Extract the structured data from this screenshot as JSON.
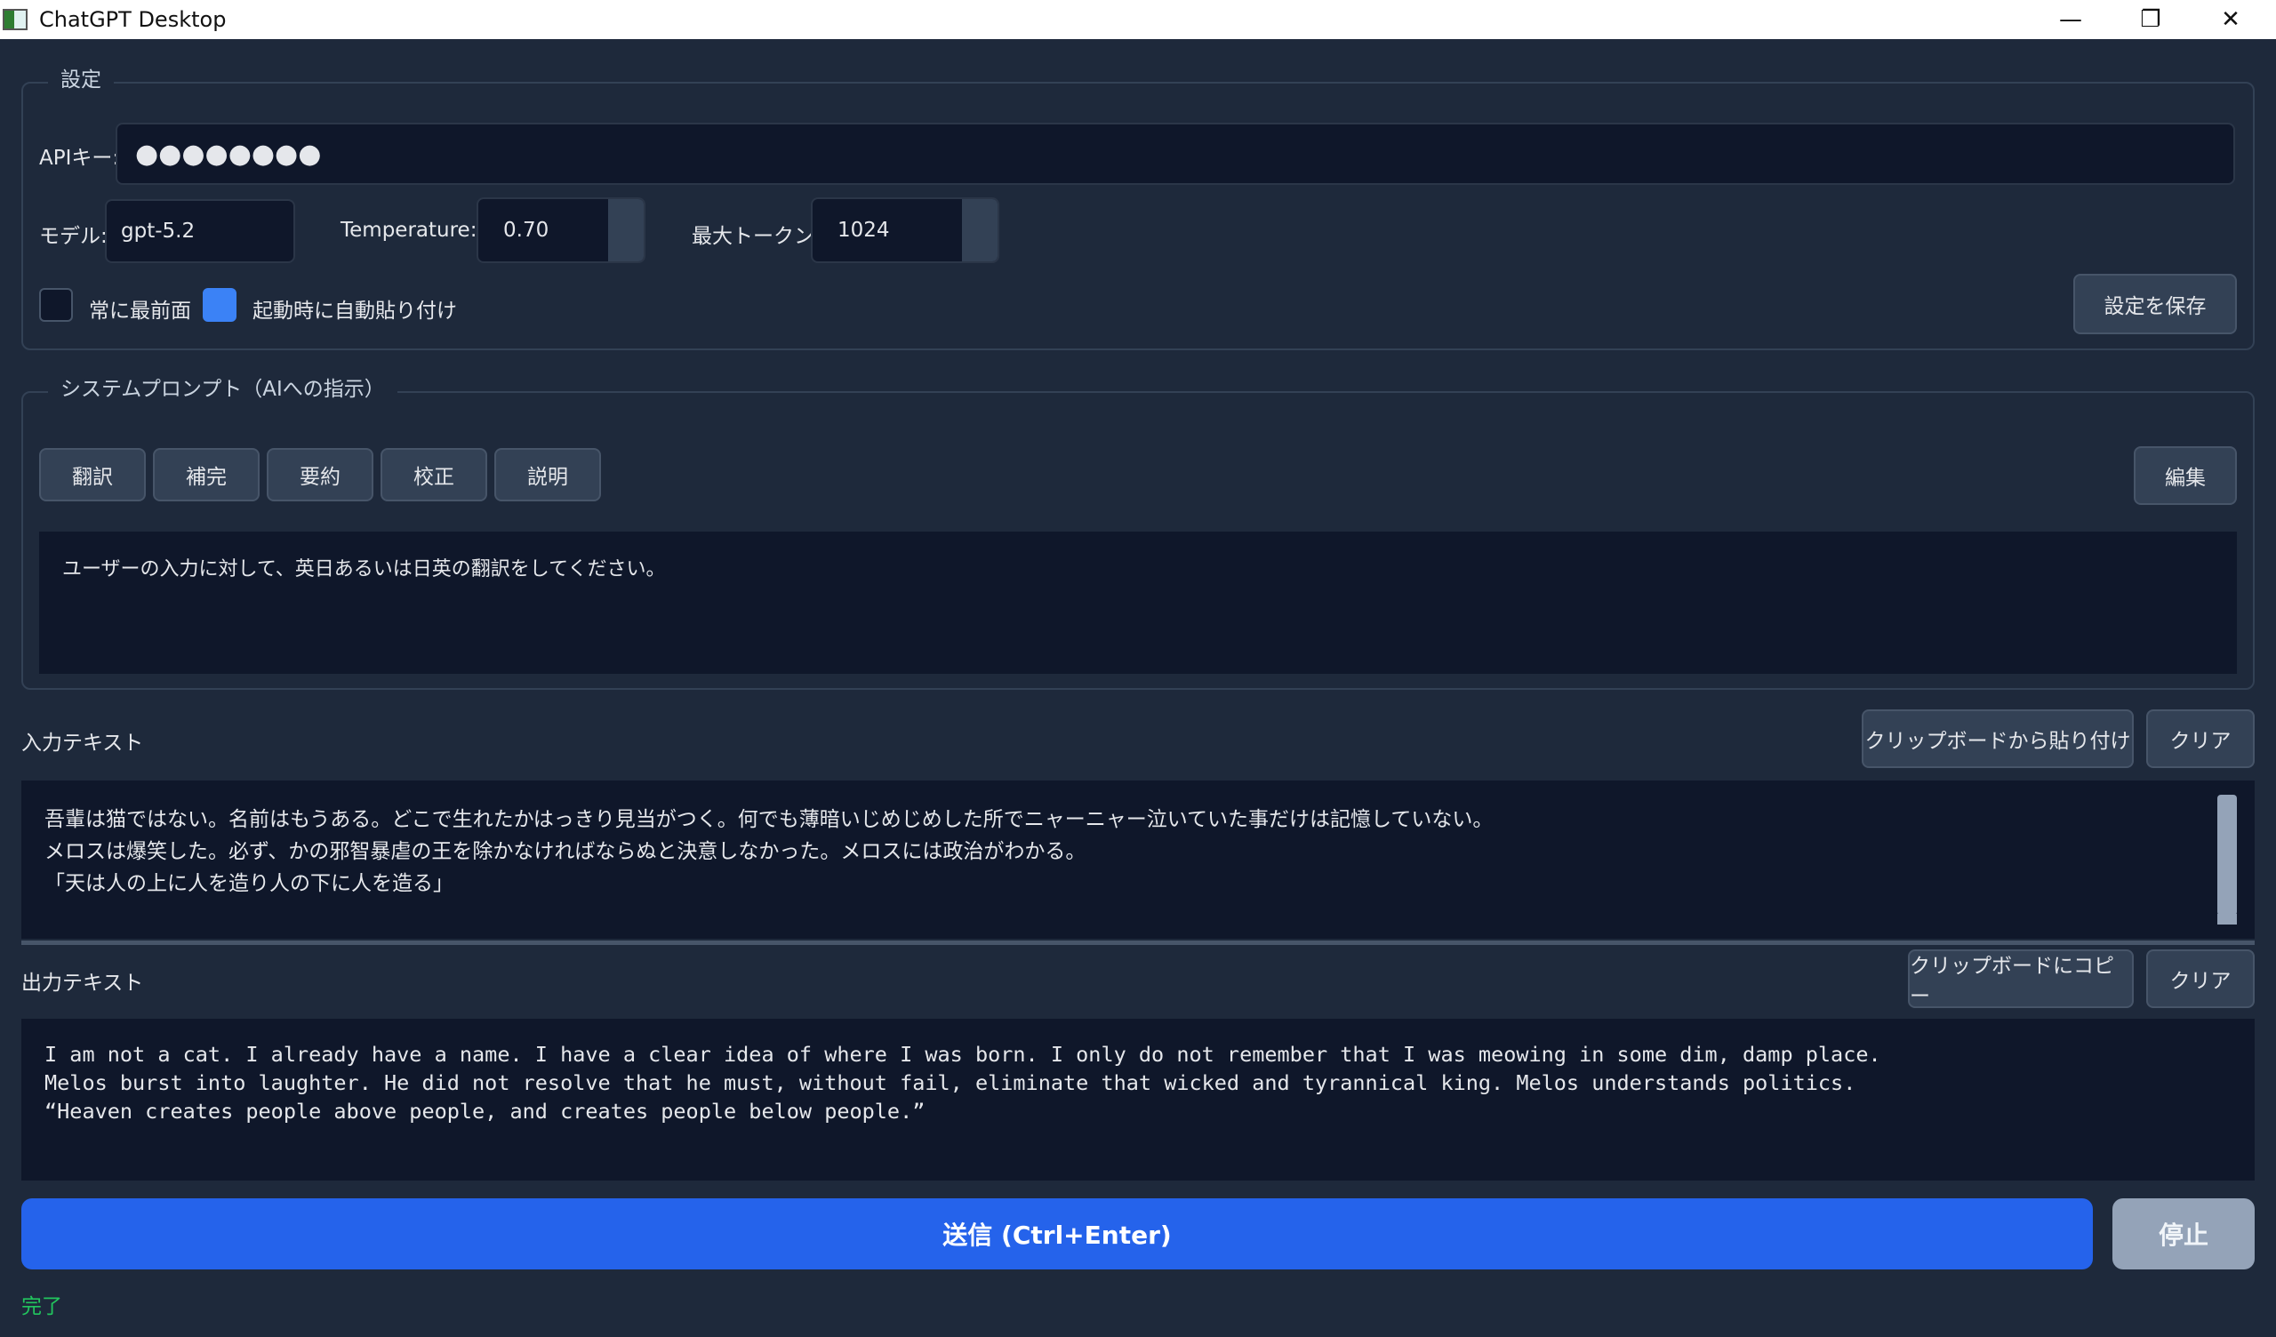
{
  "window": {
    "title": "ChatGPT Desktop",
    "minimize_icon": "—",
    "maximize_icon": "❐",
    "close_icon": "✕"
  },
  "settings": {
    "group_label": "設定",
    "api_key_label": "APIキー:",
    "api_key_value": "●●●●●●●●",
    "model_label": "モデル:",
    "model_value": "gpt-5.2",
    "temperature_label": "Temperature:",
    "temperature_value": "0.70",
    "max_tokens_label": "最大トークン:",
    "max_tokens_value": "1024",
    "always_on_top_label": "常に最前面",
    "always_on_top_checked": false,
    "auto_paste_label": "起動時に自動貼り付け",
    "auto_paste_checked": true,
    "save_button": "設定を保存"
  },
  "system_prompt": {
    "group_label": "システムプロンプト（AIへの指示）",
    "presets": [
      "翻訳",
      "補完",
      "要約",
      "校正",
      "説明"
    ],
    "edit_button": "編集",
    "text": "ユーザーの入力に対して、英日あるいは日英の翻訳をしてください。"
  },
  "input": {
    "label": "入力テキスト",
    "paste_button": "クリップボードから貼り付け",
    "clear_button": "クリア",
    "lines": [
      "吾輩は猫ではない。名前はもうある。どこで生れたかはっきり見当がつく。何でも薄暗いじめじめした所でニャーニャー泣いていた事だけは記憶していない。",
      "メロスは爆笑した。必ず、かの邪智暴虐の王を除かなければならぬと決意しなかった。メロスには政治がわかる。",
      "「天は人の上に人を造り人の下に人を造る」"
    ]
  },
  "output": {
    "label": "出力テキスト",
    "copy_button": "クリップボードにコピー",
    "clear_button": "クリア",
    "lines": [
      "I am not a cat. I already have a name. I have a clear idea of where I was born. I only do not remember that I was meowing in some dim, damp place.",
      "Melos burst into laughter. He did not resolve that he must, without fail, eliminate that wicked and tyrannical king. Melos understands politics.",
      "“Heaven creates people above people, and creates people below people.”"
    ]
  },
  "actions": {
    "send_button": "送信 (Ctrl+Enter)",
    "stop_button": "停止"
  },
  "status": {
    "text": "完了",
    "color": "#22c55e"
  },
  "colors": {
    "background": "#1e293b",
    "field": "#0f172a",
    "accent": "#2563eb",
    "checkbox_on": "#3b82f6"
  }
}
